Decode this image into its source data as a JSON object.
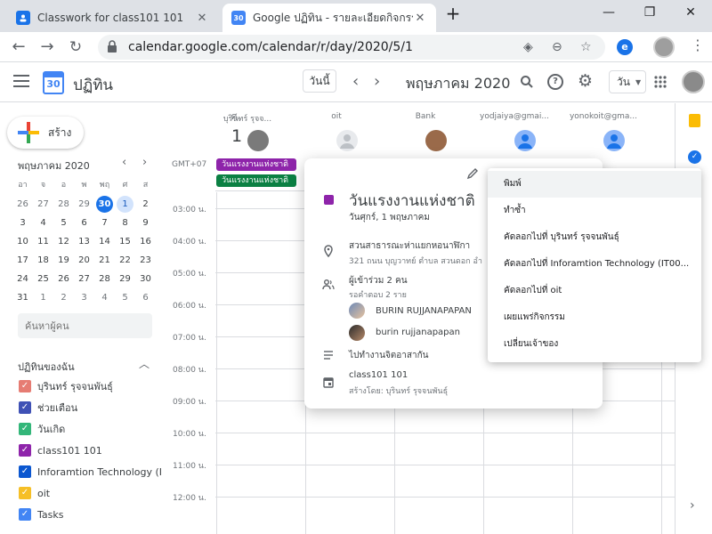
{
  "browser": {
    "tabs": [
      {
        "title": "Classwork for class101 101",
        "active": false,
        "favicon_color": "#1a73e8"
      },
      {
        "title": "Google ปฏิทิน - รายละเอียดกิจกรรม",
        "active": true,
        "favicon_color": "#4285f4",
        "favicon_text": "30"
      }
    ],
    "new_tab_icon": "plus-icon",
    "url": "calendar.google.com/calendar/r/day/2020/5/1"
  },
  "header": {
    "app_title": "ปฏิทิน",
    "logo_number": "30",
    "today_button": "วันนี้",
    "current_period": "พฤษภาคม 2020",
    "view_select": "วัน"
  },
  "sidebar": {
    "create_label": "สร้าง",
    "mini_month": "พฤษภาคม 2020",
    "weekdays": [
      "อา",
      "จ",
      "อ",
      "พ",
      "พฤ",
      "ศ",
      "ส"
    ],
    "weeks": [
      [
        "26",
        "27",
        "28",
        "29",
        "30",
        "1",
        "2"
      ],
      [
        "3",
        "4",
        "5",
        "6",
        "7",
        "8",
        "9"
      ],
      [
        "10",
        "11",
        "12",
        "13",
        "14",
        "15",
        "16"
      ],
      [
        "17",
        "18",
        "19",
        "20",
        "21",
        "22",
        "23"
      ],
      [
        "24",
        "25",
        "26",
        "27",
        "28",
        "29",
        "30"
      ],
      [
        "31",
        "1",
        "2",
        "3",
        "4",
        "5",
        "6"
      ]
    ],
    "search_placeholder": "ค้นหาผู้คน",
    "my_calendars_title": "ปฏิทินของฉัน",
    "calendars": [
      {
        "label": "บุรินทร์ รุจจนพันธุ์",
        "color": "#e67c73"
      },
      {
        "label": "ช่วยเตือน",
        "color": "#3f51b5"
      },
      {
        "label": "วันเกิด",
        "color": "#33b679"
      },
      {
        "label": "class101 101",
        "color": "#8e24aa"
      },
      {
        "label": "Inforamtion Technology (I...",
        "color": "#0b57d0"
      },
      {
        "label": "oit",
        "color": "#f6bf26"
      },
      {
        "label": "Tasks",
        "color": "#4285f4"
      }
    ]
  },
  "day_view": {
    "day_abbr": "ศ.",
    "day_number": "1",
    "timezone": "GMT+07",
    "columns": [
      {
        "name": "บุรินทร์ รุจจ...",
        "avatar": "photo"
      },
      {
        "name": "oit",
        "avatar": "generic-grey"
      },
      {
        "name": "Bank",
        "avatar": "photo"
      },
      {
        "name": "yodjaiya@gmai...",
        "avatar": "generic-blue"
      },
      {
        "name": "yonokoit@gma...",
        "avatar": "generic-blue"
      }
    ],
    "allday_events": [
      {
        "label": "วันแรงงานแห่งชาติ",
        "color": "#8e24aa"
      },
      {
        "label": "วันแรงงานแห่งชาติ",
        "color": "#0b8043"
      }
    ],
    "times": [
      "03:00 น.",
      "04:00 น.",
      "05:00 น.",
      "06:00 น.",
      "07:00 น.",
      "08:00 น.",
      "09:00 น.",
      "10:00 น.",
      "11:00 น.",
      "12:00 น."
    ]
  },
  "event_popup": {
    "title": "วันแรงงานแห่งชาติ",
    "date": "วันศุกร์, 1 พฤษภาคม",
    "color": "#8e24aa",
    "location_name": "สวนสาธารณะห่าแยกหอนาฬิกา",
    "location_address": "321 ถนน บุญวาทย์ ตำบล สวนดอก อำ",
    "guests_count": "ผู้เข้าร่วม 2 คน",
    "guests_pending": "รอคำตอบ 2 ราย",
    "guests": [
      "BURIN RUJJANAPAPAN",
      "burin rujjanapapan"
    ],
    "description": "ไปทำงานจิตอาสากัน",
    "calendar_name": "class101 101",
    "created_by": "สร้างโดย: บุรินทร์ รุจจนพันธุ์"
  },
  "context_menu": {
    "items": [
      "พิมพ์",
      "ทำซ้ำ",
      "คัดลอกไปที่ บุรินทร์ รุจจนพันธุ์",
      "คัดลอกไปที่ Inforamtion Technology (IT00...",
      "คัดลอกไปที่ oit",
      "เผยแพร่กิจกรรม",
      "เปลี่ยนเจ้าของ"
    ],
    "highlighted_index": 0
  }
}
